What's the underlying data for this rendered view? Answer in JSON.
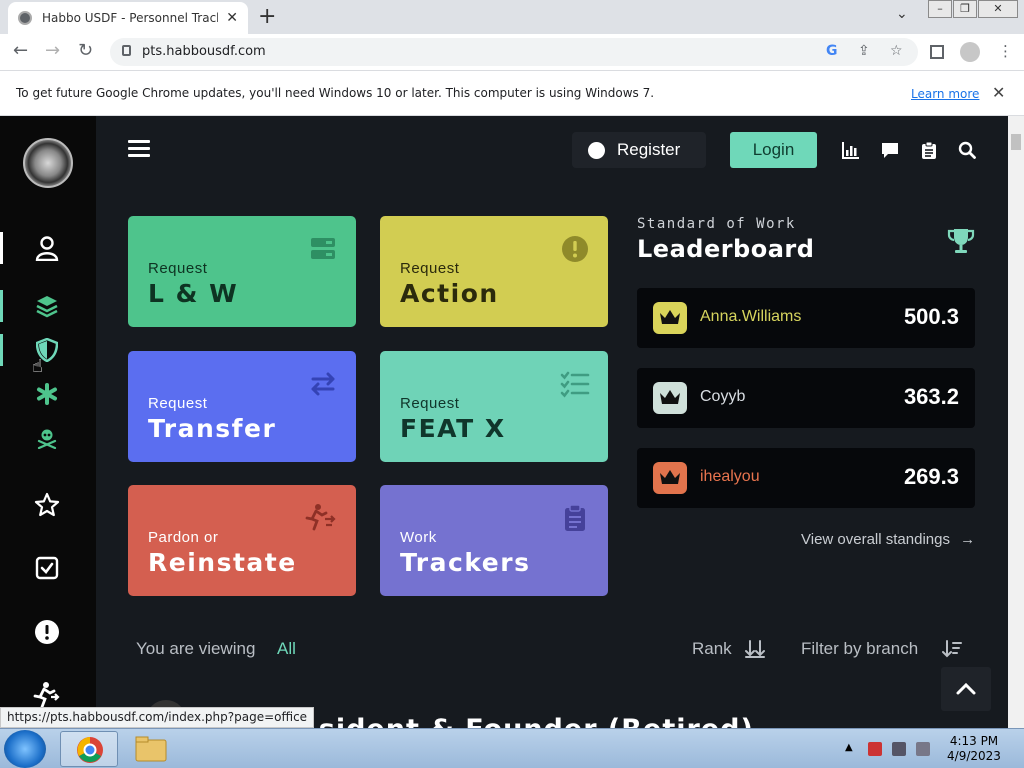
{
  "browser": {
    "tab_title": "Habbo USDF - Personnel Tracking",
    "tab_close": "✕",
    "new_tab": "+",
    "url": "pts.habbousdf.com",
    "status_url": "https://pts.habbousdf.com/index.php?page=office"
  },
  "infobar": {
    "message": "To get future Google Chrome updates, you'll need Windows 10 or later. This computer is using Windows 7.",
    "learn_more": "Learn more"
  },
  "header": {
    "register_label": "Register",
    "login_label": "Login"
  },
  "cards": [
    {
      "line1": "Request",
      "line2": "L & W",
      "color": "#4ec48c",
      "icon": "server-icon"
    },
    {
      "line1": "Request",
      "line2": "Action",
      "color": "#d2cd52",
      "icon": "alert-circle-icon"
    },
    {
      "line1": "Request",
      "line2": "Transfer",
      "color": "#5b6ef0",
      "icon": "swap-icon"
    },
    {
      "line1": "Request",
      "line2": "FEAT X",
      "color": "#6fd3b7",
      "icon": "checklist-icon"
    },
    {
      "line1": "Pardon or",
      "line2": "Reinstate",
      "color": "#d45f50",
      "icon": "runner-icon"
    },
    {
      "line1": "Work",
      "line2": "Trackers",
      "color": "#7572d0",
      "icon": "clipboard-icon"
    }
  ],
  "leaderboard": {
    "kicker": "Standard of Work",
    "title": "Leaderboard",
    "rows": [
      {
        "name": "Anna.Williams",
        "score": "500.3",
        "name_color": "#d6d45e",
        "badge_color": "#d9d45a"
      },
      {
        "name": "Coyyb",
        "score": "363.2",
        "name_color": "#d8dde2",
        "badge_color": "#cfe0da"
      },
      {
        "name": "ihealyou",
        "score": "269.3",
        "name_color": "#e7744e",
        "badge_color": "#e2744d"
      }
    ],
    "view_all": "View overall standings"
  },
  "filters": {
    "viewing_label": "You are viewing",
    "viewing_value": "All",
    "rank_label": "Rank",
    "branch_label": "Filter by branch"
  },
  "section_title": "...sident & Founder (Retired)",
  "taskbar": {
    "time": "4:13 PM",
    "date": "4/9/2023"
  }
}
